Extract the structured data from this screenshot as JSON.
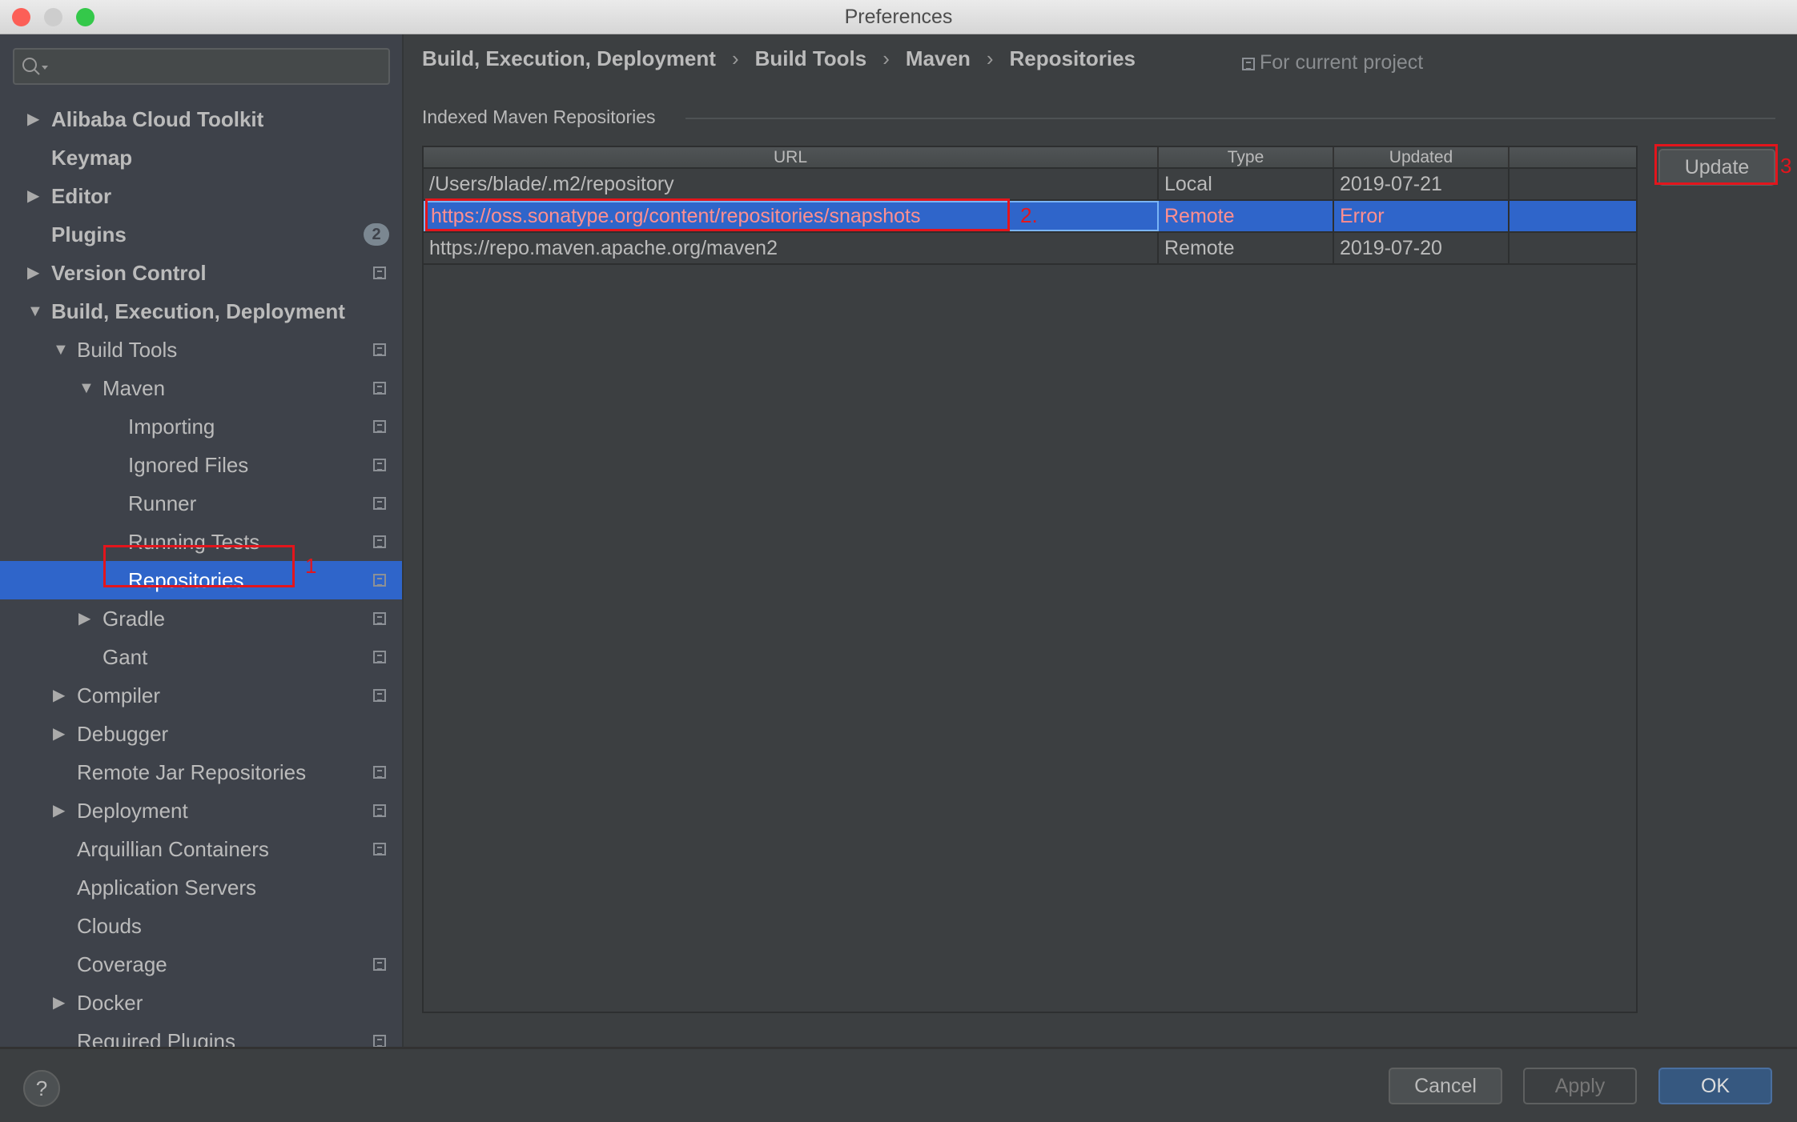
{
  "window": {
    "title": "Preferences"
  },
  "sidebar": {
    "search_placeholder": "",
    "items": [
      {
        "label": "Alibaba Cloud Toolkit",
        "level": 0,
        "arrow": "right",
        "bold": true
      },
      {
        "label": "Keymap",
        "level": 0,
        "arrow": "none",
        "bold": true
      },
      {
        "label": "Editor",
        "level": 0,
        "arrow": "right",
        "bold": true
      },
      {
        "label": "Plugins",
        "level": 0,
        "arrow": "none",
        "bold": true,
        "badge": "2"
      },
      {
        "label": "Version Control",
        "level": 0,
        "arrow": "right",
        "bold": true,
        "copy": true
      },
      {
        "label": "Build, Execution, Deployment",
        "level": 0,
        "arrow": "down",
        "bold": true
      },
      {
        "label": "Build Tools",
        "level": 1,
        "arrow": "down",
        "copy": true
      },
      {
        "label": "Maven",
        "level": 2,
        "arrow": "down",
        "copy": true
      },
      {
        "label": "Importing",
        "level": 3,
        "arrow": "none",
        "copy": true
      },
      {
        "label": "Ignored Files",
        "level": 3,
        "arrow": "none",
        "copy": true
      },
      {
        "label": "Runner",
        "level": 3,
        "arrow": "none",
        "copy": true
      },
      {
        "label": "Running Tests",
        "level": 3,
        "arrow": "none",
        "copy": true
      },
      {
        "label": "Repositories",
        "level": 3,
        "arrow": "none",
        "copy": true,
        "selected": true
      },
      {
        "label": "Gradle",
        "level": 2,
        "arrow": "right",
        "copy": true
      },
      {
        "label": "Gant",
        "level": 2,
        "arrow": "none",
        "copy": true
      },
      {
        "label": "Compiler",
        "level": 1,
        "arrow": "right",
        "copy": true
      },
      {
        "label": "Debugger",
        "level": 1,
        "arrow": "right"
      },
      {
        "label": "Remote Jar Repositories",
        "level": 1,
        "arrow": "none",
        "copy": true
      },
      {
        "label": "Deployment",
        "level": 1,
        "arrow": "right",
        "copy": true
      },
      {
        "label": "Arquillian Containers",
        "level": 1,
        "arrow": "none",
        "copy": true
      },
      {
        "label": "Application Servers",
        "level": 1,
        "arrow": "none"
      },
      {
        "label": "Clouds",
        "level": 1,
        "arrow": "none"
      },
      {
        "label": "Coverage",
        "level": 1,
        "arrow": "none",
        "copy": true
      },
      {
        "label": "Docker",
        "level": 1,
        "arrow": "right"
      },
      {
        "label": "Required Plugins",
        "level": 1,
        "arrow": "none",
        "copy": true
      }
    ]
  },
  "breadcrumb": [
    "Build, Execution, Deployment",
    "Build Tools",
    "Maven",
    "Repositories"
  ],
  "breadcrumb_sep": "›",
  "scope_label": "For current project",
  "group_label": "Indexed Maven Repositories",
  "table": {
    "columns": [
      "URL",
      "Type",
      "Updated",
      ""
    ],
    "rows": [
      {
        "url": "/Users/blade/.m2/repository",
        "type": "Local",
        "updated": "2019-07-21"
      },
      {
        "url": "https://oss.sonatype.org/content/repositories/snapshots",
        "type": "Remote",
        "updated": "Error",
        "selected": true
      },
      {
        "url": "https://repo.maven.apache.org/maven2",
        "type": "Remote",
        "updated": "2019-07-20"
      }
    ]
  },
  "update_label": "Update",
  "annotations": [
    "1",
    "2.",
    "3"
  ],
  "footer": {
    "help": "?",
    "cancel": "Cancel",
    "apply": "Apply",
    "ok": "OK"
  },
  "colors": {
    "selection": "#2f65ca",
    "annotation": "#e3151c",
    "ok_button": "#365880",
    "error_text": "#ff8f8f"
  }
}
